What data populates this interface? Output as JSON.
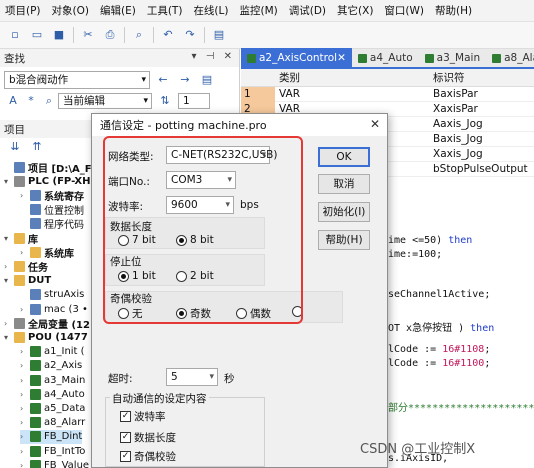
{
  "menubar": {
    "items": [
      "项目(P)",
      "对象(O)",
      "编辑(E)",
      "工具(T)",
      "在线(L)",
      "监控(M)",
      "调试(D)",
      "其它(X)",
      "窗口(W)",
      "帮助(H)"
    ]
  },
  "toolbar": {
    "icons": [
      "new-icon",
      "open-icon",
      "save-icon",
      "cut-icon",
      "print-icon",
      "search-icon",
      "undo-icon",
      "redo-icon",
      "compile-icon"
    ]
  },
  "find_panel": {
    "title": "查找",
    "search_value": "b混合阀动作",
    "scope_value": "当前编辑",
    "count_value": "1"
  },
  "project_panel": {
    "title": "项目",
    "items": [
      {
        "label": "项目 [D:\\A_FILE",
        "indent": 0,
        "icon": "doc",
        "bold": true
      },
      {
        "label": "PLC (FP-XH",
        "indent": 0,
        "icon": "grey",
        "bold": true,
        "arrow": "▾"
      },
      {
        "label": "系统寄存",
        "indent": 1,
        "icon": "doc",
        "bold": true,
        "arrow": "›"
      },
      {
        "label": "位置控制",
        "indent": 1,
        "icon": "doc"
      },
      {
        "label": "程序代码",
        "indent": 1,
        "icon": "doc"
      },
      {
        "label": "库",
        "indent": 0,
        "icon": "fold",
        "bold": true,
        "arrow": "▾"
      },
      {
        "label": "系统库",
        "indent": 1,
        "icon": "fold",
        "bold": true,
        "arrow": "›"
      },
      {
        "label": "任务",
        "indent": 0,
        "icon": "fold",
        "bold": true,
        "arrow": "›"
      },
      {
        "label": "DUT",
        "indent": 0,
        "icon": "fold",
        "bold": true,
        "arrow": "▾"
      },
      {
        "label": "struAxis",
        "indent": 1,
        "icon": "doc"
      },
      {
        "label": "mac (3 •",
        "indent": 1,
        "icon": "doc",
        "arrow": "›"
      },
      {
        "label": "全局变量 (12",
        "indent": 0,
        "icon": "grey",
        "bold": true,
        "arrow": "›"
      },
      {
        "label": "POU (1477",
        "indent": 0,
        "icon": "fold",
        "bold": true,
        "arrow": "▾"
      },
      {
        "label": "a1_Init (",
        "indent": 1,
        "icon": "pou",
        "arrow": "›"
      },
      {
        "label": "a2_Axis",
        "indent": 1,
        "icon": "pou",
        "arrow": "›"
      },
      {
        "label": "a3_Main",
        "indent": 1,
        "icon": "pou",
        "arrow": "›"
      },
      {
        "label": "a4_Auto",
        "indent": 1,
        "icon": "pou",
        "arrow": "›"
      },
      {
        "label": "a5_Data",
        "indent": 1,
        "icon": "pou",
        "arrow": "›"
      },
      {
        "label": "a8_Alarr",
        "indent": 1,
        "icon": "pou",
        "arrow": "›"
      },
      {
        "label": "FB_Dint",
        "indent": 1,
        "icon": "pou",
        "arrow": "›",
        "selected": true
      },
      {
        "label": "FB_IntTo",
        "indent": 1,
        "icon": "pou",
        "arrow": "›"
      },
      {
        "label": "FB_Value",
        "indent": 1,
        "icon": "pou",
        "arrow": "›"
      }
    ]
  },
  "editor": {
    "tabs": [
      {
        "label": "a2_AxisControl",
        "active": true
      },
      {
        "label": "a4_Auto"
      },
      {
        "label": "a3_Main"
      },
      {
        "label": "a8_Ala"
      }
    ],
    "columns": [
      "类别",
      "标识符"
    ],
    "rows": [
      {
        "num": "1",
        "type": "VAR",
        "id": "BaxisPar"
      },
      {
        "num": "2",
        "type": "VAR",
        "id": "XaxisPar"
      },
      {
        "num": "",
        "type": "",
        "id": "Aaxis_Jog"
      },
      {
        "num": "",
        "type": "",
        "id": "Baxis_Jog"
      },
      {
        "num": "",
        "type": "",
        "id": "Xaxis_Jog"
      },
      {
        "num": "",
        "type": "",
        "id": "bStopPulseOutput"
      }
    ],
    "code": [
      {
        "text": "ime <=50) then",
        "kw": "then"
      },
      {
        "text": "ime:=100;"
      },
      {
        "text": "seChannel1Active;"
      },
      {
        "text": "OT x急停按钮 ) then",
        "kw": "then"
      },
      {
        "text": "lCode := 16#1108;",
        "num": "16#1108"
      },
      {
        "text": "lCode := 16#1100;",
        "num": "16#1100"
      },
      {
        "text": "部分*********************",
        "cmt": true
      },
      {
        "text": "s.iAxisID,"
      }
    ]
  },
  "dialog": {
    "title": "通信设定 - potting machine.pro",
    "close": "✕",
    "network_label": "网络类型:",
    "network_value": "C-NET(RS232C,USB)",
    "port_label": "端口No.:",
    "port_value": "COM3",
    "baud_label": "波特率:",
    "baud_value": "9600",
    "baud_unit": "bps",
    "data_length": {
      "title": "数据长度",
      "options": [
        "7 bit",
        "8 bit"
      ],
      "selected": 1
    },
    "stop_bit": {
      "title": "停止位",
      "options": [
        "1 bit",
        "2 bit"
      ],
      "selected": 0
    },
    "parity": {
      "title": "奇偶校验",
      "options": [
        "无",
        "奇数",
        "偶数",
        ""
      ],
      "selected": 1
    },
    "timeout_label": "超时:",
    "timeout_value": "5",
    "timeout_unit": "秒",
    "auto_group_title": "自动通信的设定内容",
    "auto_checks": [
      "波特率",
      "数据长度",
      "奇偶校验"
    ],
    "buttons": {
      "ok": "OK",
      "cancel": "取消",
      "init": "初始化(I)",
      "help": "帮助(H)"
    }
  },
  "watermark": "CSDN @工业控制X"
}
